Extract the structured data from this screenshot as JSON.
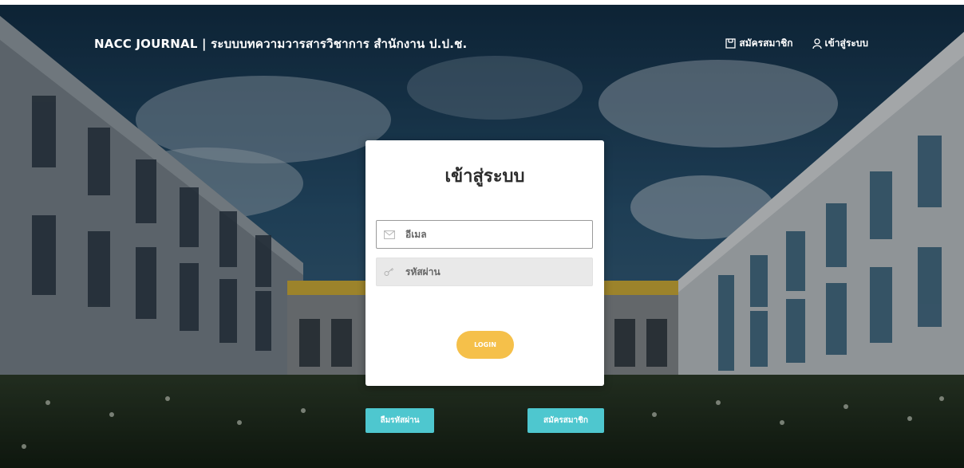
{
  "header": {
    "brand": "NACC JOURNAL | ระบบบทความวารสารวิชาการ สำนักงาน ป.ป.ช.",
    "nav": [
      {
        "label": "สมัครสมาชิก",
        "icon": "register-icon"
      },
      {
        "label": "เข้าสู่ระบบ",
        "icon": "user-icon"
      }
    ]
  },
  "login": {
    "title": "เข้าสู่ระบบ",
    "email_placeholder": "อีเมล",
    "email_value": "",
    "password_placeholder": "รหัสผ่าน",
    "password_value": "",
    "login_label": "LOGIN"
  },
  "footer_buttons": {
    "forgot_label": "ลืมรหัสผ่าน",
    "register_label": "สมัครสมาชิก"
  },
  "colors": {
    "accent_yellow": "#f5c04a",
    "accent_teal": "#4ec7cf",
    "card_bg": "#ffffff"
  }
}
